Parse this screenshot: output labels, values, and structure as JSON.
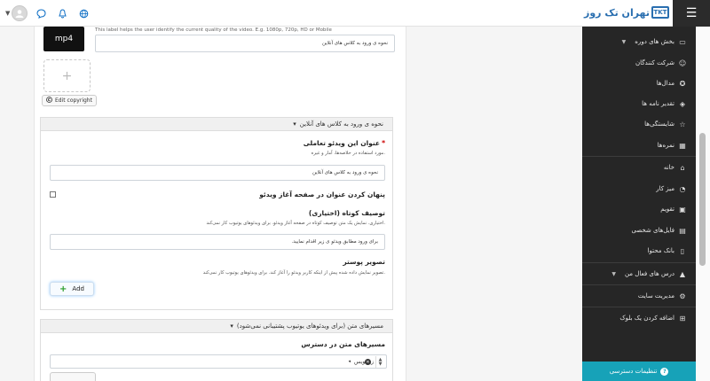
{
  "header": {
    "logo_text": "تهران تک روز",
    "logo_abbr": "TKT"
  },
  "video": {
    "thumb_label": "mp4",
    "quality_help": "This label helps the user identify the current quality of the video. E.g. 1080p, 720p, HD or Mobile",
    "quality_value": "نحوه ی ورود به کلاس های آنلاین",
    "edit_copyright_label": "Edit copyright"
  },
  "section1": {
    "header": "نحوه ی ورود به کلاس های آنلاین",
    "title_label": "عنوان این ویدئو تعاملی",
    "title_help": ".مورد استفاده در خلاصه‌ها، آمار و غیره",
    "title_value": "نحوه ی ورود به کلاس های آنلاین",
    "hide_title_label": "پنهان کردن عنوان در صفحه آغاز ویدئو",
    "short_desc_label": "توصیف کوتاه (اختیاری)",
    "short_desc_help": ".اختیاری. نمایش یک متن توصیف کوتاه در صفحه آغاز ویدئو. برای ویدئوهای یوتیوب کار نمی‌کند",
    "short_desc_value": "برای ورود مطابق ویدئو ی زیر اقدام نمایید.",
    "poster_label": "تصویر پوستر",
    "poster_help": ".تصویر نمایش داده شده پیش از اینکه کاربر ویدئو را آغاز کند. برای ویدئوهای یوتیوب کار نمی‌کند",
    "add_label": "Add"
  },
  "section2": {
    "header": "مسیرهای متن (برای ویدئوهای یوتیوب پشتیبانی نمی‌شود)",
    "tracks_label": "مسیرهای متن در دسترس",
    "select_value": "زیرنویس"
  },
  "sidebar": {
    "items": [
      {
        "label": "بخش های دوره",
        "icon": "folder-icon",
        "arrow": true
      },
      {
        "label": "شرکت کنندگان",
        "icon": "users-icon"
      },
      {
        "label": "مدال‌ها",
        "icon": "badge-icon"
      },
      {
        "label": "تقدیر نامه ها",
        "icon": "layers-icon"
      },
      {
        "label": "شایستگی‌ها",
        "icon": "star-icon"
      },
      {
        "label": "نمره‌ها",
        "icon": "table-icon"
      },
      {
        "label": "خانه",
        "icon": "home-icon"
      },
      {
        "label": "میز کار",
        "icon": "dashboard-icon"
      },
      {
        "label": "تقویم",
        "icon": "calendar-icon"
      },
      {
        "label": "فایل‌های شخصی",
        "icon": "file-icon"
      },
      {
        "label": "بانک محتوا",
        "icon": "book-icon"
      },
      {
        "label": "درس های فعال من",
        "icon": "graduation-icon",
        "arrow": true
      },
      {
        "label": "مدیریت سایت",
        "icon": "gear-icon"
      },
      {
        "label": "اضافه کردن یک بلوک",
        "icon": "plus-square-icon"
      }
    ],
    "footer": "تنظیمات دسترسی"
  }
}
